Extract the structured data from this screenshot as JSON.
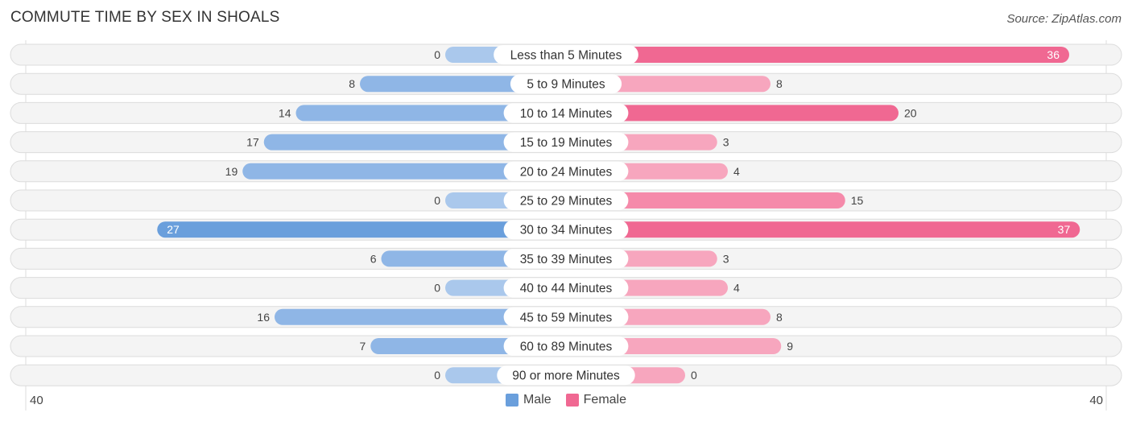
{
  "title": "COMMUTE TIME BY SEX IN SHOALS",
  "source": "Source: ZipAtlas.com",
  "colors": {
    "male": "#6a9fdc",
    "male_light": "#aac8ec",
    "female": "#f06892",
    "female_light": "#f7a6be"
  },
  "chart_data": {
    "type": "bar",
    "orientation": "horizontal-diverging",
    "title": "COMMUTE TIME BY SEX IN SHOALS",
    "categories": [
      "Less than 5 Minutes",
      "5 to 9 Minutes",
      "10 to 14 Minutes",
      "15 to 19 Minutes",
      "20 to 24 Minutes",
      "25 to 29 Minutes",
      "30 to 34 Minutes",
      "35 to 39 Minutes",
      "40 to 44 Minutes",
      "45 to 59 Minutes",
      "60 to 89 Minutes",
      "90 or more Minutes"
    ],
    "series": [
      {
        "name": "Male",
        "values": [
          0,
          8,
          14,
          17,
          19,
          0,
          27,
          6,
          0,
          16,
          7,
          0
        ]
      },
      {
        "name": "Female",
        "values": [
          36,
          8,
          20,
          3,
          4,
          15,
          37,
          3,
          4,
          8,
          9,
          0
        ]
      }
    ],
    "axis_min_label": "40",
    "axis_max_label": "40",
    "xlim": [
      -40,
      40
    ],
    "legend": [
      "Male",
      "Female"
    ],
    "legend_position": "bottom-center"
  }
}
